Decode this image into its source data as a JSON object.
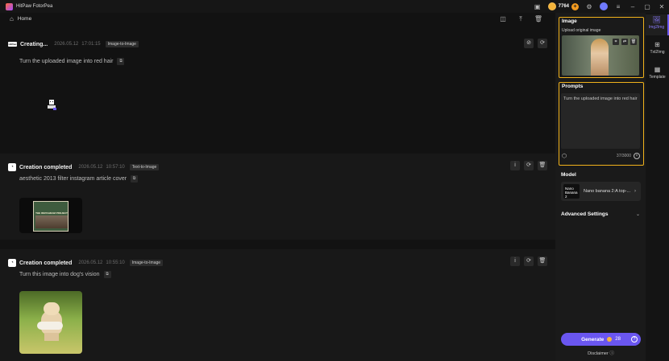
{
  "app": {
    "name": "HitPaw FotorPea",
    "coins": "7764"
  },
  "home": {
    "label": "Home"
  },
  "cards": [
    {
      "status": "Creating...",
      "date": "2026.05.12",
      "time": "17:01:15",
      "tag": "Image-to-Image",
      "prompt": "Turn the uploaded image into red hair",
      "logo": "HitPaw"
    },
    {
      "status": "Creation completed",
      "date": "2026.05.12",
      "time": "10:57:10",
      "tag": "Text-to-Image",
      "prompt": "aesthetic 2013 filter instagram article cover",
      "thumb_caption": "THE INSTAGRAM PROJECT"
    },
    {
      "status": "Creation completed",
      "date": "2026.05.12",
      "time": "10:55:10",
      "tag": "Image-to-Image",
      "prompt": "Turn this image into dog's vision"
    }
  ],
  "panel": {
    "image_title": "Image",
    "upload_label": "Upload original image",
    "prompts_title": "Prompts",
    "prompt_value": "Turn the uploaded image into red hair",
    "counter": "37/3000",
    "model_title": "Model",
    "model_thumb": "Nano Banana 2",
    "model_name": "Nano banana 2:A top-...",
    "advanced_label": "Advanced Settings",
    "generate_label": "Generate",
    "generate_cost": "28",
    "disclaimer": "Disclaimer"
  },
  "nav": [
    {
      "label": "Img2Img",
      "icon": "image-edit-icon"
    },
    {
      "label": "Txt2Img",
      "icon": "text-image-icon"
    },
    {
      "label": "Template",
      "icon": "template-icon"
    }
  ],
  "colors": {
    "accent": "#6a56f0",
    "highlight": "#f1b21b",
    "coin": "#f5b43a"
  }
}
